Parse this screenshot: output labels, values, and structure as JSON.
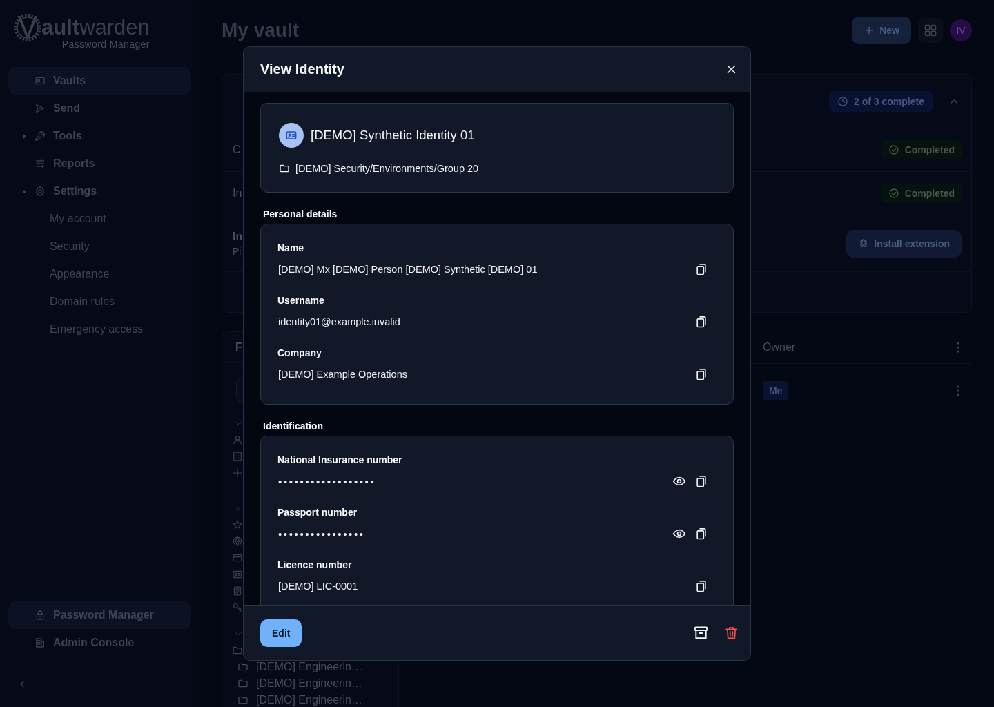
{
  "sidebar": {
    "logo": {
      "mark": "V",
      "name": "**ault**warden",
      "subtitle": "Password Manager"
    },
    "items": [
      {
        "label": "Vaults",
        "selected": true
      },
      {
        "label": "Send",
        "selected": false
      },
      {
        "label": "Tools",
        "selected": false,
        "expanded": false
      },
      {
        "label": "Reports",
        "selected": false
      },
      {
        "label": "Settings",
        "selected": false,
        "expanded": true,
        "children": [
          {
            "label": "My account",
            "selected": false
          },
          {
            "label": "Security",
            "selected": false
          },
          {
            "label": "Appearance",
            "selected": false
          },
          {
            "label": "Domain rules",
            "selected": false
          },
          {
            "label": "Emergency access",
            "selected": false
          }
        ]
      }
    ],
    "products": [
      {
        "label": "Password Manager",
        "selected": true
      },
      {
        "label": "Admin Console",
        "selected": false
      }
    ]
  },
  "header": {
    "title": "My vault",
    "new_button": "New",
    "avatar": "IV"
  },
  "onboarding": {
    "progress": "2 of 3 complete",
    "expanded": true,
    "tasks": [
      {
        "kind": "done",
        "title": "C",
        "status": "Completed"
      },
      {
        "kind": "done",
        "title": "In",
        "status": "Completed"
      },
      {
        "kind": "action",
        "title": "In",
        "subtitle": "Pi",
        "action": "Install extension"
      }
    ]
  },
  "filters": {
    "title": "F",
    "folders": [
      "[DEMO] Engineerin…",
      "[DEMO] Engineerin…",
      "[DEMO] Engineerin…"
    ]
  },
  "table": {
    "columns": [
      "Owner"
    ],
    "rows": [
      {
        "owner": "Me"
      }
    ]
  },
  "dialog": {
    "title": "View Identity",
    "item": {
      "name": "[DEMO] Synthetic Identity 01",
      "folder": "[DEMO] Security/Environments/Group 20"
    },
    "sections": [
      {
        "title": "Personal details",
        "fields": [
          {
            "label": "Name",
            "value": "[DEMO] Mx [DEMO] Person [DEMO] Synthetic [DEMO] 01",
            "masked": false
          },
          {
            "label": "Username",
            "value": "identity01@example.invalid",
            "masked": false
          },
          {
            "label": "Company",
            "value": "[DEMO] Example Operations",
            "masked": false
          }
        ]
      },
      {
        "title": "Identification",
        "fields": [
          {
            "label": "National Insurance number",
            "value": "••••••••••••••••••",
            "masked": true
          },
          {
            "label": "Passport number",
            "value": "••••••••••••••••",
            "masked": true
          },
          {
            "label": "Licence number",
            "value": "[DEMO] LIC-0001",
            "masked": false
          }
        ]
      }
    ],
    "edit_button": "Edit"
  }
}
